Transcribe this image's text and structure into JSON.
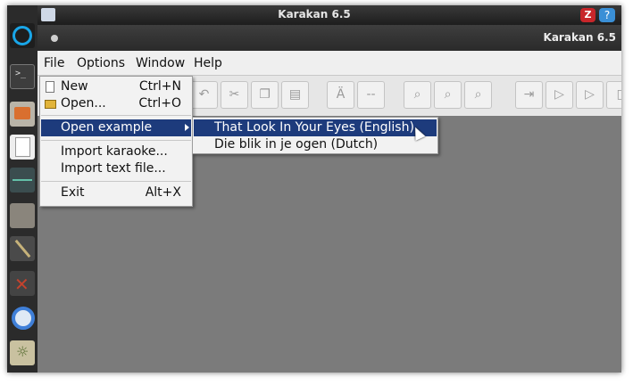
{
  "system": {
    "top_title": "Karakan 6.5",
    "indicator_red": "Z",
    "indicator_blue": "?"
  },
  "launcher": {
    "icons": [
      "ubuntu-icon",
      "terminal-icon",
      "files-icon",
      "text-editor-icon",
      "system-monitor-icon",
      "book-icon",
      "tool-icon",
      "x-app-icon",
      "chrome-icon",
      "brightness-icon"
    ]
  },
  "window": {
    "title": "Karakan 6.5"
  },
  "menubar": {
    "file": "File",
    "options": "Options",
    "window": "Window",
    "help": "Help"
  },
  "toolbar": {
    "buttons": [
      {
        "name": "undo",
        "glyph": "↶"
      },
      {
        "name": "cut",
        "glyph": "✂"
      },
      {
        "name": "copy",
        "glyph": "❐"
      },
      {
        "name": "paste",
        "glyph": "▤"
      },
      {
        "name": "special-char",
        "glyph": "Ä"
      },
      {
        "name": "separator",
        "glyph": "--"
      },
      {
        "name": "find",
        "glyph": "⌕"
      },
      {
        "name": "find-next",
        "glyph": "⌕"
      },
      {
        "name": "replace",
        "glyph": "⌕"
      },
      {
        "name": "import",
        "glyph": "⇥"
      },
      {
        "name": "play",
        "glyph": "▷"
      },
      {
        "name": "play-selection",
        "glyph": "▷"
      },
      {
        "name": "stop",
        "glyph": "▯"
      }
    ]
  },
  "file_menu": {
    "new_label": "New",
    "new_shortcut": "Ctrl+N",
    "open_label": "Open...",
    "open_shortcut": "Ctrl+O",
    "open_example_label": "Open example",
    "import_karaoke_label": "Import karaoke...",
    "import_text_label": "Import text file...",
    "exit_label": "Exit",
    "exit_shortcut": "Alt+X"
  },
  "example_submenu": {
    "items": [
      "That Look In Your Eyes (English)",
      "Die blik in je ogen (Dutch)"
    ]
  }
}
